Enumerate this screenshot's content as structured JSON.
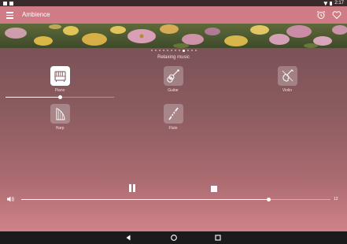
{
  "status_bar": {
    "time": "2:17"
  },
  "app_bar": {
    "title": "Ambience"
  },
  "hero": {
    "pages": 12,
    "active_page": 8
  },
  "category": {
    "title": "Relaxing music"
  },
  "instruments": [
    {
      "label": "Piano",
      "icon": "piano-icon",
      "active": true
    },
    {
      "label": "Guitar",
      "icon": "guitar-icon",
      "active": false
    },
    {
      "label": "Violin",
      "icon": "violin-icon",
      "active": false
    },
    {
      "label": "Harp",
      "icon": "harp-icon",
      "active": false
    },
    {
      "label": "Flute",
      "icon": "flute-icon",
      "active": false
    }
  ],
  "piano_volume": 0.5,
  "player": {
    "pause_icon": "pause-icon",
    "stop_icon": "stop-icon"
  },
  "master_volume": {
    "value": 12,
    "max": 15,
    "icon": "speaker-icon"
  },
  "colors": {
    "app_bar": "#cf7c86",
    "background_top": "#7c5257",
    "background_bottom": "#cf8288",
    "active_tile": "#ffffff"
  }
}
